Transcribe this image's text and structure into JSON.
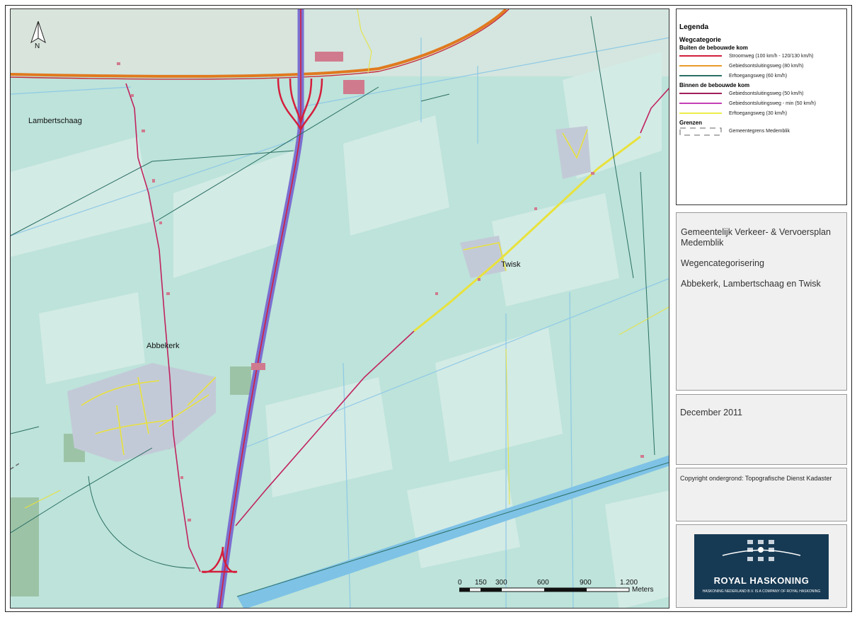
{
  "map": {
    "places": [
      {
        "name": "Lambertschaag"
      },
      {
        "name": "Abbekerk"
      },
      {
        "name": "Twisk"
      }
    ],
    "north_label": "N",
    "scale": {
      "ticks": [
        "0",
        "150",
        "300",
        "600",
        "900",
        "1.200"
      ],
      "unit": "Meters"
    },
    "colors": {
      "water": "#bde3da",
      "land": "#cfe9e3",
      "stroomweg": "#d41e3c",
      "gebiedsontsluiting80": "#e89b2b",
      "erftoegang60": "#2a6e63",
      "gebiedsontsluiting50": "#c0235f",
      "min50": "#c33fb7",
      "erftoegang30": "#ecec4a"
    }
  },
  "legend": {
    "title": "Legenda",
    "section": "Wegcategorie",
    "group1_title": "Buiten de bebouwde kom",
    "group1": [
      {
        "label": "Stroomweg (100 km/h - 120/130 km/h)",
        "color": "#d41e3c"
      },
      {
        "label": "Gebiedsontsluitingsweg (80 km/h)",
        "color": "#e89b2b"
      },
      {
        "label": "Erftoegangsweg (60 km/h)",
        "color": "#2a6e63"
      }
    ],
    "group2_title": "Binnen de bebouwde kom",
    "group2": [
      {
        "label": "Gebiedsontsluitingsweg (50 km/h)",
        "color": "#a01e5a"
      },
      {
        "label": "Gebiedsontsluitingsweg - min (50 km/h)",
        "color": "#c33fb7"
      },
      {
        "label": "Erftoegangsweg (30 km/h)",
        "color": "#ecec4a"
      }
    ],
    "group3_title": "Grenzen",
    "group3": [
      {
        "label": "Gemeentegrens Medemblik",
        "color": "#666666"
      }
    ]
  },
  "title_block": {
    "line1": "Gemeentelijk Verkeer- & Vervoersplan",
    "line2": "Medemblik",
    "line3": "Wegencategorisering",
    "line4": "Abbekerk, Lambertschaag en Twisk"
  },
  "date": "December 2011",
  "copyright": "Copyright ondergrond: Topografische Dienst Kadaster",
  "logo": {
    "name": "ROYAL HASKONING",
    "tagline": "HASKONING NEDERLAND B.V. IS A COMPANY OF ROYAL HASKONING"
  }
}
